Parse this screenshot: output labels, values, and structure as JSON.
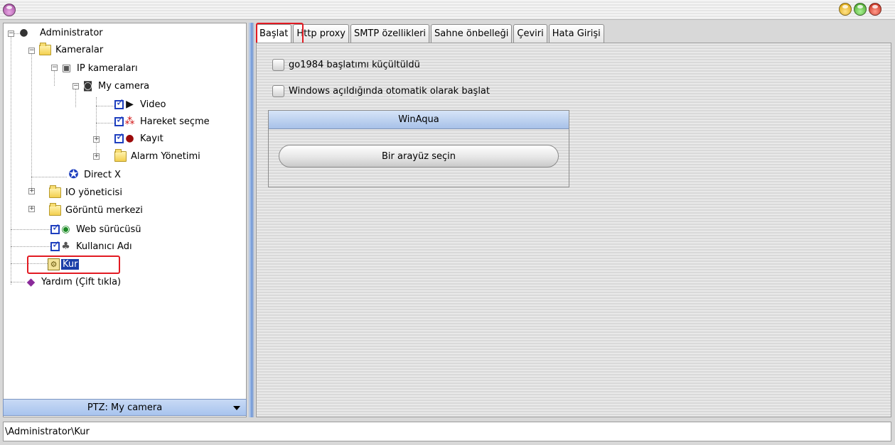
{
  "window": {
    "title_buttons": [
      "menu-orb",
      "minimize",
      "maximize",
      "close"
    ],
    "colors": {
      "selection": "#1a3ea8",
      "highlight_box": "#e21a22",
      "splitter": "#6d95d6",
      "checkbox": "#1e3fbf"
    }
  },
  "tree": {
    "items": [
      {
        "label": "Administrator",
        "icon": "admin-icon"
      },
      {
        "label": "Kameralar",
        "icon": "open-folder-icon"
      },
      {
        "label": "IP kameraları",
        "icon": "network-camera-icon"
      },
      {
        "label": "My camera",
        "icon": "camera-icon"
      },
      {
        "label": "Video",
        "icon": "play-icon",
        "checked": true
      },
      {
        "label": "Hareket seçme",
        "icon": "motion-icon",
        "checked": true
      },
      {
        "label": "Kayıt",
        "icon": "record-icon",
        "checked": true
      },
      {
        "label": "Alarm Yönetimi",
        "icon": "folder-icon"
      },
      {
        "label": "Direct X",
        "icon": "directx-icon"
      },
      {
        "label": "IO yöneticisi",
        "icon": "folder-icon"
      },
      {
        "label": "Görüntü merkezi",
        "icon": "folder-icon"
      },
      {
        "label": "Web sürücüsü",
        "icon": "globe-icon",
        "checked": true
      },
      {
        "label": "Kullanıcı Adı",
        "icon": "users-icon",
        "checked": true
      },
      {
        "label": "Kur",
        "icon": "setup-icon",
        "selected": true
      },
      {
        "label": "Yardım (Çift tıkla)",
        "icon": "help-book-icon"
      }
    ]
  },
  "ptz": {
    "label": "PTZ: My camera"
  },
  "tabs": [
    {
      "label": "Başlat",
      "active": true
    },
    {
      "label": "Http proxy"
    },
    {
      "label": "SMTP özellikleri"
    },
    {
      "label": "Sahne önbelleği"
    },
    {
      "label": "Çeviri"
    },
    {
      "label": "Hata Girişi"
    }
  ],
  "startup": {
    "option_minimized": "go1984 başlatımı küçültüldü",
    "option_autostart": "Windows açıldığında otomatik olarak başlat",
    "group_title": "WinAqua",
    "choose_button": "Bir arayüz seçin"
  },
  "status": {
    "path": "\\Administrator\\Kur"
  }
}
